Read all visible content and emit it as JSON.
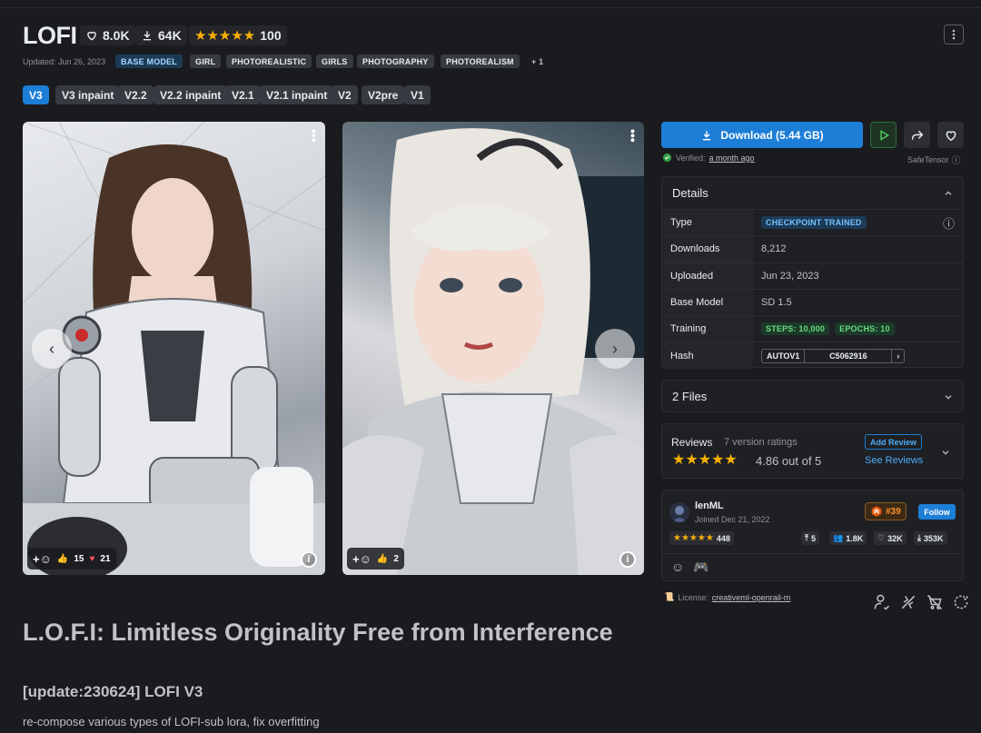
{
  "model": {
    "title": "LOFI",
    "likes": "8.0K",
    "downloads": "64K",
    "rating_count": "100",
    "updated": "Updated: Jun 26, 2023",
    "tags": [
      "BASE MODEL",
      "GIRL",
      "PHOTOREALISTIC",
      "GIRLS",
      "PHOTOGRAPHY",
      "PHOTOREALISM",
      "+ 1"
    ],
    "versions": [
      "V3",
      "V3 inpaint",
      "V2.2",
      "V2.2 inpaint",
      "V2.1",
      "V2.1 inpaint",
      "V2",
      "V2pre",
      "V1"
    ],
    "active_version": "V3"
  },
  "gallery": {
    "image1": {
      "likes": "15",
      "hearts": "21",
      "alt": "robot-suit girl"
    },
    "image2": {
      "likes": "2",
      "alt": "silver-hair girl"
    }
  },
  "download": {
    "label": "Download (5.44 GB)",
    "verified_prefix": "Verified:",
    "verified_when": "a month ago",
    "format": "SafeTensor"
  },
  "details": {
    "heading": "Details",
    "rows": {
      "type_k": "Type",
      "type_v": "CHECKPOINT TRAINED",
      "downloads_k": "Downloads",
      "downloads_v": "8,212",
      "uploaded_k": "Uploaded",
      "uploaded_v": "Jun 23, 2023",
      "base_k": "Base Model",
      "base_v": "SD 1.5",
      "training_k": "Training",
      "steps": "STEPS: 10,000",
      "epochs": "EPOCHS: 10",
      "hash_k": "Hash",
      "hash_type": "AUTOV1",
      "hash_v": "C5062916"
    }
  },
  "files": {
    "label": "2 Files"
  },
  "reviews": {
    "heading": "Reviews",
    "count": "7 version ratings",
    "score": "4.86 out of 5",
    "add": "Add Review",
    "see": "See Reviews"
  },
  "creator": {
    "name": "lenML",
    "joined": "Joined Dec 21, 2022",
    "rank": "#39",
    "follow": "Follow",
    "rating": "448",
    "uploads": "5",
    "followers": "1.8K",
    "likes": "32K",
    "downloads": "353K"
  },
  "license": {
    "prefix": "License:",
    "name": "creativeml-openrail-m"
  },
  "description": {
    "heading": "L.O.F.I: Limitless Originality Free from Interference",
    "update": "[update:230624] LOFI V3",
    "text": "re-compose various types of LOFI-sub lora, fix overfitting"
  },
  "colors": {
    "accent": "#1c7ed6",
    "star": "#fab005",
    "bg": "#1a1b1e"
  }
}
